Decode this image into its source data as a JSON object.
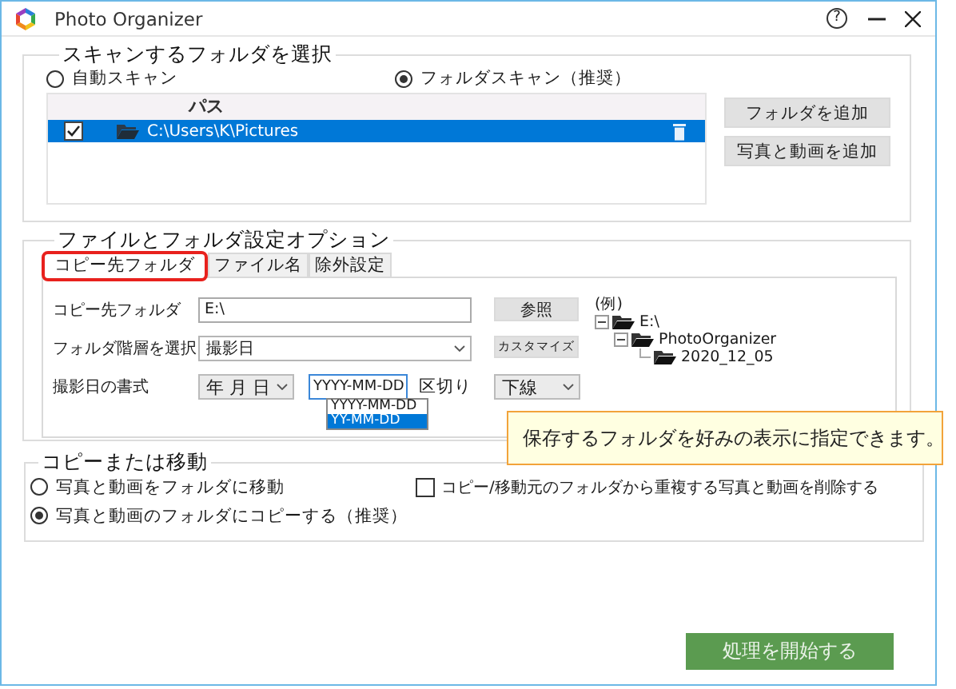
{
  "window": {
    "title": "Photo Organizer",
    "help": "?"
  },
  "scan_group": {
    "title": "スキャンするフォルダを選択",
    "options": [
      {
        "label": "自動スキャン",
        "selected": false
      },
      {
        "label": "フォルダスキャン（推奨）",
        "selected": true
      }
    ],
    "list": {
      "columns": [
        "パス"
      ],
      "rows": [
        {
          "path": "C:\\Users\\K\\Pictures",
          "checked": true,
          "selected": true
        }
      ]
    },
    "buttons": [
      "フォルダを追加",
      "写真と動画を追加"
    ]
  },
  "options_group": {
    "title": "ファイルとフォルダ設定オプション",
    "tabs": [
      {
        "label": "コピー先フォルダ",
        "selected": true,
        "highlighted": true
      },
      {
        "label": "ファイル名",
        "selected": false,
        "highlighted": false
      },
      {
        "label": "除外設定",
        "selected": false,
        "highlighted": false
      }
    ],
    "destination": {
      "label": "コピー先フォルダ",
      "value": "E:\\",
      "button": "参照"
    },
    "hierarchy": {
      "label": "フォルダ階層を選択",
      "value": "撮影日",
      "button": "カスタマイズ"
    },
    "date_format": {
      "label": "撮影日の書式",
      "order": "年 月 日",
      "format": "YYYY-MM-DD",
      "format_options": [
        {
          "label": "YYYY-MM-DD",
          "selected": false
        },
        {
          "label": "YY-MM-DD",
          "selected": true
        }
      ],
      "separator_label": "区切り",
      "separator": "下線"
    },
    "example": {
      "label": "(例)",
      "tree": [
        {
          "label": "E:\\",
          "expanded": true,
          "children": [
            {
              "label": "PhotoOrganizer",
              "expanded": true,
              "children": [
                {
                  "label": "2020_12_05"
                }
              ]
            }
          ]
        }
      ]
    }
  },
  "tooltip": {
    "text": "保存するフォルダを好みの表示に指定できます。"
  },
  "copy_move": {
    "title": "コピーまたは移動",
    "options": [
      {
        "label": "写真と動画をフォルダに移動",
        "selected": false
      },
      {
        "label": "写真と動画のフォルダにコピーする（推奨）",
        "selected": true
      }
    ],
    "delete_duplicates": {
      "label": "コピー/移動元のフォルダから重複する写真と動画を削除する",
      "checked": false
    }
  },
  "start_button": "処理を開始する"
}
